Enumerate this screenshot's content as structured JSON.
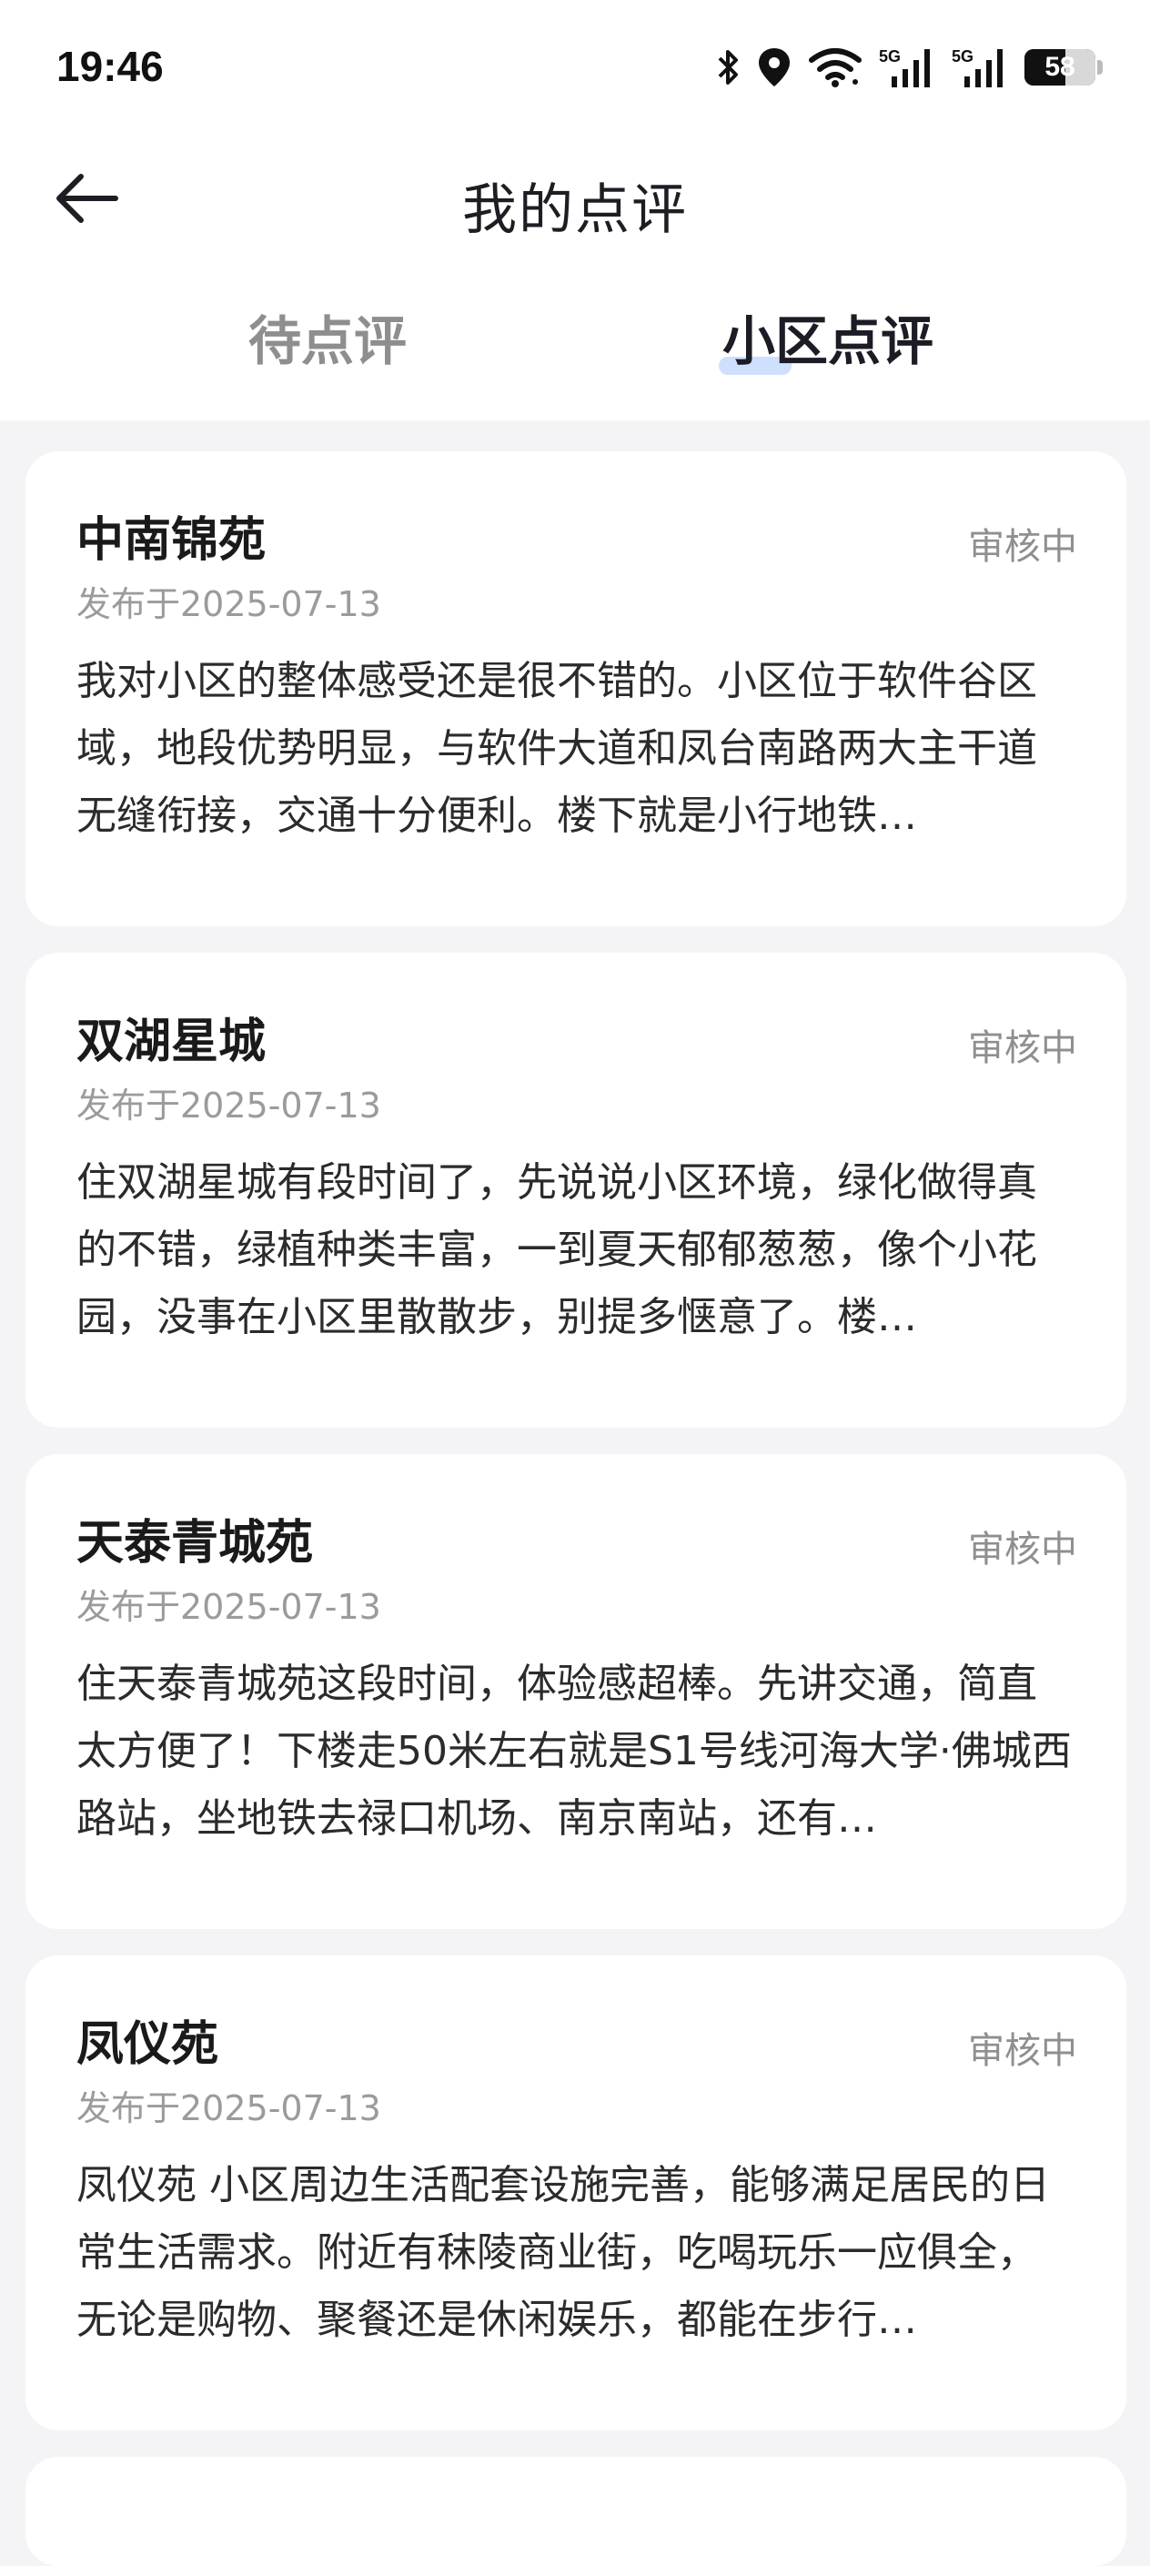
{
  "status_bar": {
    "time": "19:46",
    "battery": "58",
    "battery_level": 0.58,
    "signal_1_label": "5G",
    "signal_2_label": "5G",
    "icons": [
      "bluetooth-icon",
      "location-icon",
      "wifi-icon",
      "signal-5g-icon",
      "signal-5g-icon",
      "battery-icon"
    ]
  },
  "header": {
    "title": "我的点评",
    "back_icon": "arrow-left-icon"
  },
  "tabs": [
    {
      "label": "待点评",
      "active": false
    },
    {
      "label": "小区点评",
      "active": true
    }
  ],
  "colors": {
    "background": "#f4f4f6",
    "card": "#ffffff",
    "active_tab_accent": "#cfe0ff",
    "muted_text": "#8f8f8f"
  },
  "reviews": [
    {
      "name": "中南锦苑",
      "status": "审核中",
      "date": "发布于2025-07-13",
      "content": "我对小区的整体感受还是很不错的。小区位于软件谷区域，地段优势明显，与软件大道和凤台南路两大主干道无缝衔接，交通十分便利。楼下就是小行地铁…"
    },
    {
      "name": "双湖星城",
      "status": "审核中",
      "date": "发布于2025-07-13",
      "content": "住双湖星城有段时间了，先说说小区环境，绿化做得真的不错，绿植种类丰富，一到夏天郁郁葱葱，像个小花园，没事在小区里散散步，别提多惬意了。楼…"
    },
    {
      "name": "天泰青城苑",
      "status": "审核中",
      "date": "发布于2025-07-13",
      "content": "住天泰青城苑这段时间，体验感超棒。先讲交通，简直太方便了！下楼走50米左右就是S1号线河海大学·佛城西路站，坐地铁去禄口机场、南京南站，还有…"
    },
    {
      "name": "凤仪苑",
      "status": "审核中",
      "date": "发布于2025-07-13",
      "content": "凤仪苑 小区周边生活配套设施完善，能够满足居民的日常生活需求。附近有秣陵商业街，吃喝玩乐一应俱全，无论是购物、聚餐还是休闲娱乐，都能在步行…"
    }
  ]
}
